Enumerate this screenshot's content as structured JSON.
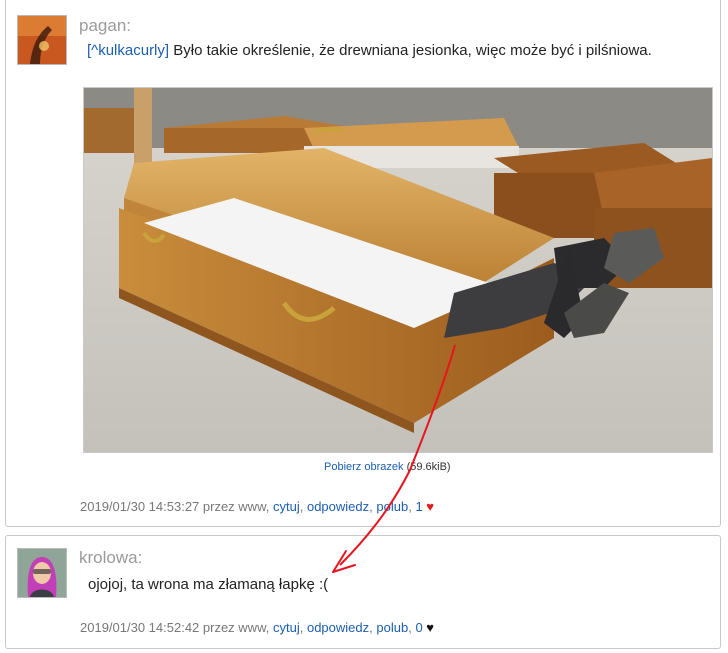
{
  "posts": [
    {
      "author": "pagan:",
      "reply_ref": "[^kulkacurly]",
      "body": "Było takie określenie, że drewniana jesionka, więc może być i pilśniowa.",
      "download_label": "Pobierz obrazek",
      "download_size": "(59.6kiB)",
      "meta_prefix": "2019/01/30 14:53:27 przez www,",
      "actions": [
        "cytuj",
        "odpowiedz",
        "polub"
      ],
      "likes": "1",
      "heart": "♥"
    },
    {
      "author": "krolowa:",
      "body": "ojojoj, ta wrona ma złamaną łapkę :(",
      "meta_prefix": "2019/01/30 14:52:42 przez www,",
      "actions": [
        "cytuj",
        "odpowiedz",
        "polub"
      ],
      "likes": "0",
      "heart": "♥"
    }
  ],
  "colors": {
    "link": "#1d5fb0",
    "nick": "#9a9a9a",
    "heart_liked": "#e21b1b",
    "annotation_arrow": "#e8141e"
  }
}
